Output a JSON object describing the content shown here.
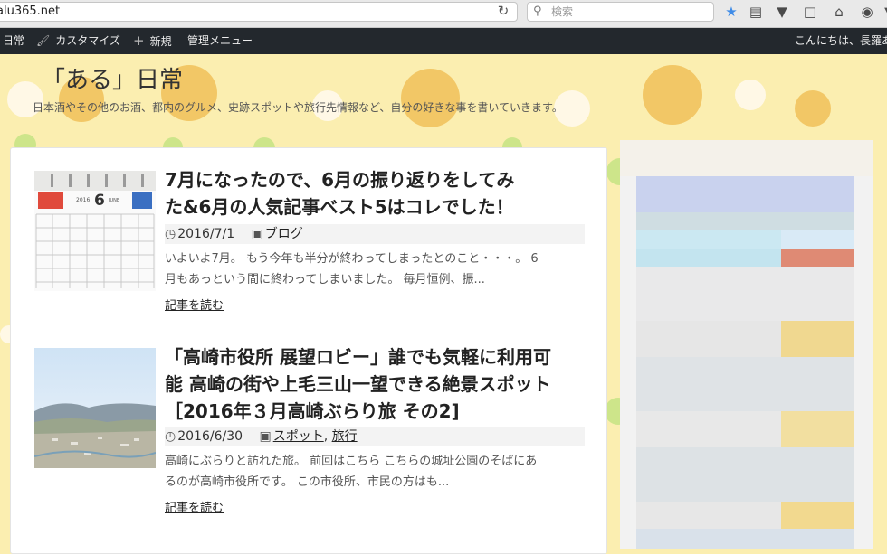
{
  "browser": {
    "url": "alu365.net",
    "search_placeholder": "検索"
  },
  "admin_bar": {
    "site_name": "日常",
    "customize": "カスタマイズ",
    "new": "新規",
    "admin_menu": "管理メニュー",
    "greeting": "こんにちは、長羅あ"
  },
  "site": {
    "title": "「ある」日常",
    "description": "日本酒やその他のお酒、都内のグルメ、史跡スポットや旅行先情報など、自分の好きな事を書いていきます。"
  },
  "posts": [
    {
      "title_line1": "7月になったので、6月の振り返りをしてみ",
      "title_line2": "た&6月の人気記事ベスト5はコレでした！",
      "date": "2016/7/1",
      "category": "ブログ",
      "excerpt_line1": "いよいよ7月。 もう今年も半分が終わってしまったとのこと・・・。 6",
      "excerpt_line2": "月もあっという間に終わってしまいました。 毎月恒例、振...",
      "read_more": "記事を読む",
      "thumb_month_number": "6",
      "thumb_month_name": "JUNE",
      "thumb_year": "2016"
    },
    {
      "title_line1": "「高崎市役所 展望ロビー」誰でも気軽に利用可",
      "title_line2": "能 高崎の街や上毛三山一望できる絶景スポット",
      "title_line3": "［2016年３月高崎ぶらり旅 その2]",
      "date": "2016/6/30",
      "category1": "スポット",
      "separator": ",",
      "category2": "旅行",
      "excerpt_line1": "高崎にぶらりと訪れた旅。 前回はこちら こちらの城址公園のそばにあ",
      "excerpt_line2": "るのが高崎市役所です。 この市役所、市民の方はも...",
      "read_more": "記事を読む"
    }
  ],
  "colors": {
    "page_bg": "#fbeeb0",
    "admin_bar_bg": "#23282d",
    "polka_orange": "#f2c766",
    "polka_white": "#fff8e6",
    "polka_green": "#cde58a"
  }
}
